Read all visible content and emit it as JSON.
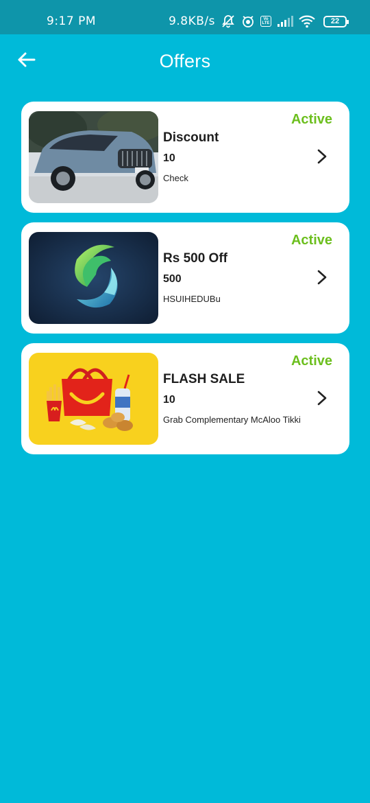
{
  "status_bar": {
    "time": "9:17 PM",
    "network_speed": "9.8KB/s",
    "battery_level": "22",
    "icons": [
      "alarm-off-icon",
      "focus-icon",
      "volte-icon",
      "signal-icon",
      "wifi-icon",
      "battery-icon"
    ],
    "volte_line1": "Vo",
    "volte_line2": "LTE"
  },
  "header": {
    "title": "Offers",
    "back_icon": "arrow-left-icon"
  },
  "colors": {
    "background": "#00BAD9",
    "status_bar": "#0E95AA",
    "active_status": "#6CBF1E",
    "card": "#FFFFFF"
  },
  "offers": [
    {
      "title": "Discount",
      "amount": "10",
      "description": "Check",
      "status": "Active",
      "image": "suv-car-image"
    },
    {
      "title": "Rs 500 Off",
      "amount": "500",
      "description": "HSUIHEDUBu",
      "status": "Active",
      "image": "swirl-logo-image"
    },
    {
      "title": "FLASH SALE",
      "amount": "10",
      "description": "Grab Complementary McAloo Tikki",
      "status": "Active",
      "image": "happy-meal-image"
    }
  ]
}
